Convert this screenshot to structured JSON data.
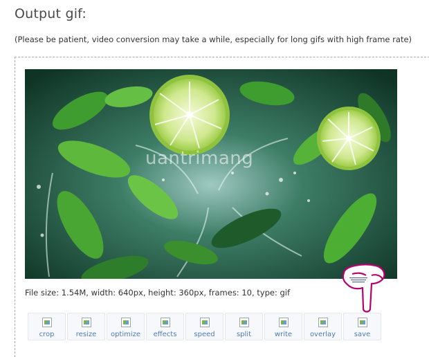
{
  "page": {
    "heading": "Output gif:",
    "note": "(Please be patient, video conversion may take a while, especially for long gifs with high frame rate)",
    "file_info": "File size: 1.54M, width: 640px, height: 360px, frames: 10, type: gif",
    "watermark": "uantrimang"
  },
  "toolbar": {
    "tools": [
      {
        "label": "crop",
        "icon": "crop-icon"
      },
      {
        "label": "resize",
        "icon": "resize-icon"
      },
      {
        "label": "optimize",
        "icon": "optimize-icon"
      },
      {
        "label": "effects",
        "icon": "effects-icon"
      },
      {
        "label": "speed",
        "icon": "speed-icon"
      },
      {
        "label": "split",
        "icon": "split-icon"
      },
      {
        "label": "write",
        "icon": "write-icon"
      },
      {
        "label": "overlay",
        "icon": "overlay-icon"
      },
      {
        "label": "save",
        "icon": "save-icon"
      }
    ]
  },
  "colors": {
    "link": "#4d7bb0",
    "hand_annotation": "#b5006e",
    "image_dark_green": "#1c4a36",
    "lime": "#c9e58a"
  }
}
